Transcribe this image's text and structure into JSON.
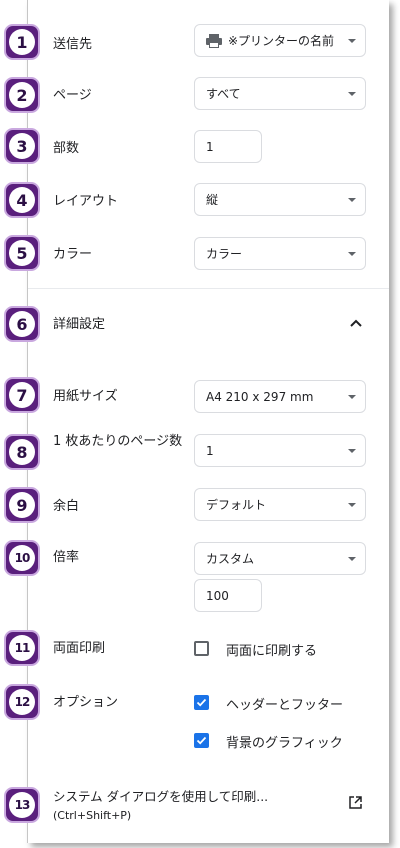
{
  "settings": {
    "destination": {
      "label": "送信先",
      "value": "※プリンターの名前"
    },
    "pages": {
      "label": "ページ",
      "value": "すべて"
    },
    "copies": {
      "label": "部数",
      "value": "1"
    },
    "layout": {
      "label": "レイアウト",
      "value": "縦"
    },
    "color": {
      "label": "カラー",
      "value": "カラー"
    },
    "advanced": {
      "label": "詳細設定"
    },
    "paper_size": {
      "label": "用紙サイズ",
      "value": "A4 210 x 297 mm"
    },
    "pages_per_sheet": {
      "label": "1 枚あたりのページ数",
      "value": "1"
    },
    "margins": {
      "label": "余白",
      "value": "デフォルト"
    },
    "scale": {
      "label": "倍率",
      "value": "カスタム",
      "custom_value": "100"
    },
    "two_sided": {
      "label": "両面印刷",
      "checkbox_label": "両面に印刷する",
      "checked": false
    },
    "options": {
      "label": "オプション",
      "headers_footers": "ヘッダーとフッター",
      "headers_footers_checked": true,
      "background_graphics": "背景のグラフィック",
      "background_graphics_checked": true
    },
    "system_dialog": {
      "label": "システム ダイアログを使用して印刷...",
      "shortcut": "(Ctrl+Shift+P)"
    }
  },
  "badges": [
    "1",
    "2",
    "3",
    "4",
    "5",
    "6",
    "7",
    "8",
    "9",
    "10",
    "11",
    "12",
    "13"
  ],
  "colors": {
    "badge": "#5a1f7d",
    "checkbox": "#1a73e8"
  }
}
